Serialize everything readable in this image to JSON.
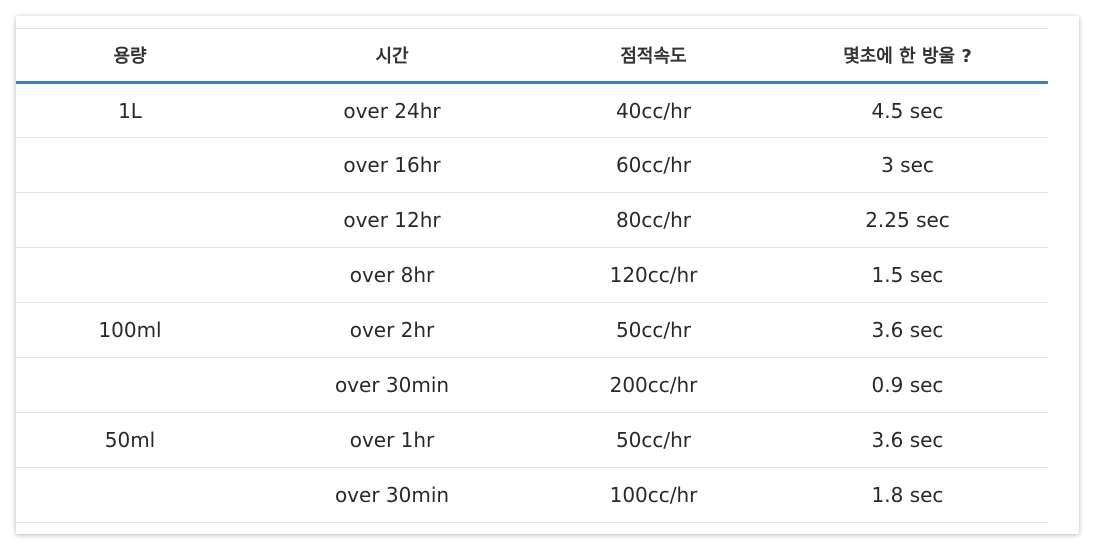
{
  "table": {
    "headers": [
      "용량",
      "시간",
      "점적속도",
      "몇초에 한 방울 ?"
    ],
    "rows": [
      {
        "volume": "1L",
        "time": "over 24hr",
        "rate": "40cc/hr",
        "drop_interval": "4.5 sec"
      },
      {
        "volume": "",
        "time": "over 16hr",
        "rate": "60cc/hr",
        "drop_interval": "3 sec"
      },
      {
        "volume": "",
        "time": "over 12hr",
        "rate": "80cc/hr",
        "drop_interval": "2.25 sec"
      },
      {
        "volume": "",
        "time": "over 8hr",
        "rate": "120cc/hr",
        "drop_interval": "1.5 sec"
      },
      {
        "volume": "100ml",
        "time": "over 2hr",
        "rate": "50cc/hr",
        "drop_interval": "3.6 sec"
      },
      {
        "volume": "",
        "time": "over 30min",
        "rate": "200cc/hr",
        "drop_interval": "0.9 sec"
      },
      {
        "volume": "50ml",
        "time": "over 1hr",
        "rate": "50cc/hr",
        "drop_interval": "3.6 sec"
      },
      {
        "volume": "",
        "time": "over 30min",
        "rate": "100cc/hr",
        "drop_interval": "1.8 sec"
      }
    ]
  },
  "colors": {
    "header_rule": "#3a7fc4",
    "row_divider": "#e2e2e2",
    "text": "#2a2a2a"
  }
}
